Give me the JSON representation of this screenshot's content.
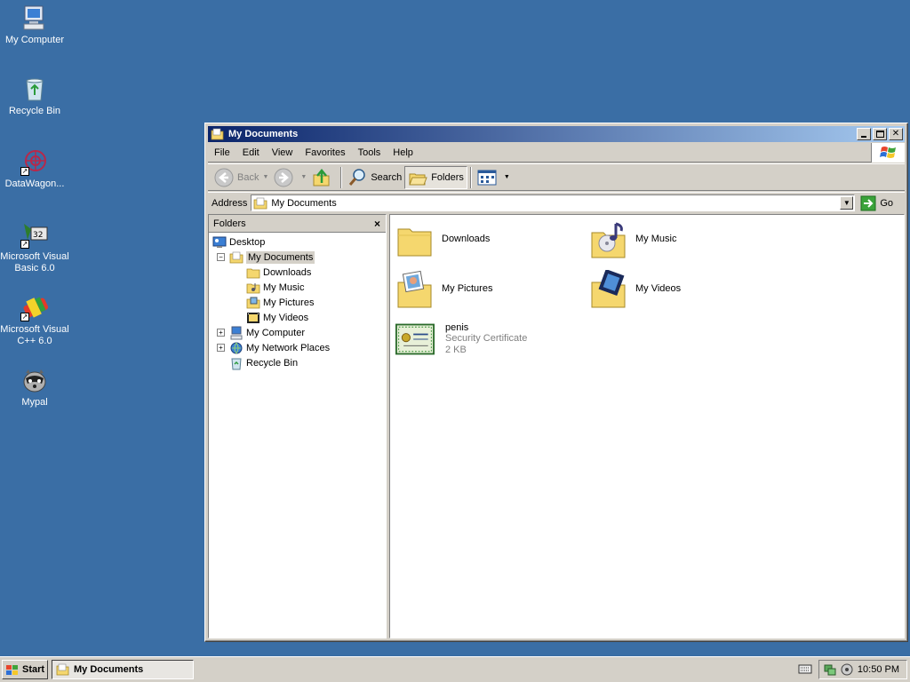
{
  "desktop": {
    "icons": [
      {
        "label": "My Computer",
        "icon": "my-computer-icon"
      },
      {
        "label": "Recycle Bin",
        "icon": "recycle-bin-icon"
      },
      {
        "label": "DataWagon...",
        "icon": "datawagon-icon"
      },
      {
        "label": "Microsoft Visual Basic 6.0",
        "icon": "visual-basic-icon"
      },
      {
        "label": "Microsoft Visual C++ 6.0",
        "icon": "visual-cpp-icon"
      },
      {
        "label": "Mypal",
        "icon": "mypal-raccoon-icon"
      }
    ]
  },
  "window": {
    "title": "My Documents",
    "menu": [
      "File",
      "Edit",
      "View",
      "Favorites",
      "Tools",
      "Help"
    ],
    "toolbar": {
      "back": "Back",
      "search": "Search",
      "folders": "Folders"
    },
    "address": {
      "label": "Address",
      "value": "My Documents",
      "go": "Go"
    },
    "folders_pane": {
      "title": "Folders",
      "close": "×",
      "tree": [
        {
          "label": "Desktop",
          "icon": "desktop-icon"
        },
        {
          "label": "My Documents",
          "icon": "my-documents-icon",
          "expander": "−"
        },
        {
          "label": "Downloads",
          "icon": "folder-icon"
        },
        {
          "label": "My Music",
          "icon": "music-folder-icon"
        },
        {
          "label": "My Pictures",
          "icon": "pictures-folder-icon"
        },
        {
          "label": "My Videos",
          "icon": "videos-folder-icon"
        },
        {
          "label": "My Computer",
          "icon": "my-computer-icon",
          "expander": "+"
        },
        {
          "label": "My Network Places",
          "icon": "network-places-icon",
          "expander": "+"
        },
        {
          "label": "Recycle Bin",
          "icon": "recycle-bin-icon"
        }
      ]
    },
    "items": [
      {
        "name": "Downloads",
        "icon": "folder-icon"
      },
      {
        "name": "My Music",
        "icon": "music-folder-icon"
      },
      {
        "name": "My Pictures",
        "icon": "pictures-folder-icon"
      },
      {
        "name": "My Videos",
        "icon": "videos-folder-icon"
      },
      {
        "name": "penis",
        "type": "Security Certificate",
        "size": "2 KB",
        "icon": "certificate-icon"
      }
    ]
  },
  "taskbar": {
    "start": "Start",
    "task": "My Documents",
    "clock": "10:50 PM"
  },
  "colors": {
    "desktop": "#3a6ea5",
    "titlebar_start": "#0a246a",
    "titlebar_end": "#a6caf0",
    "face": "#d4d0c8",
    "folder": "#f5d76e"
  }
}
